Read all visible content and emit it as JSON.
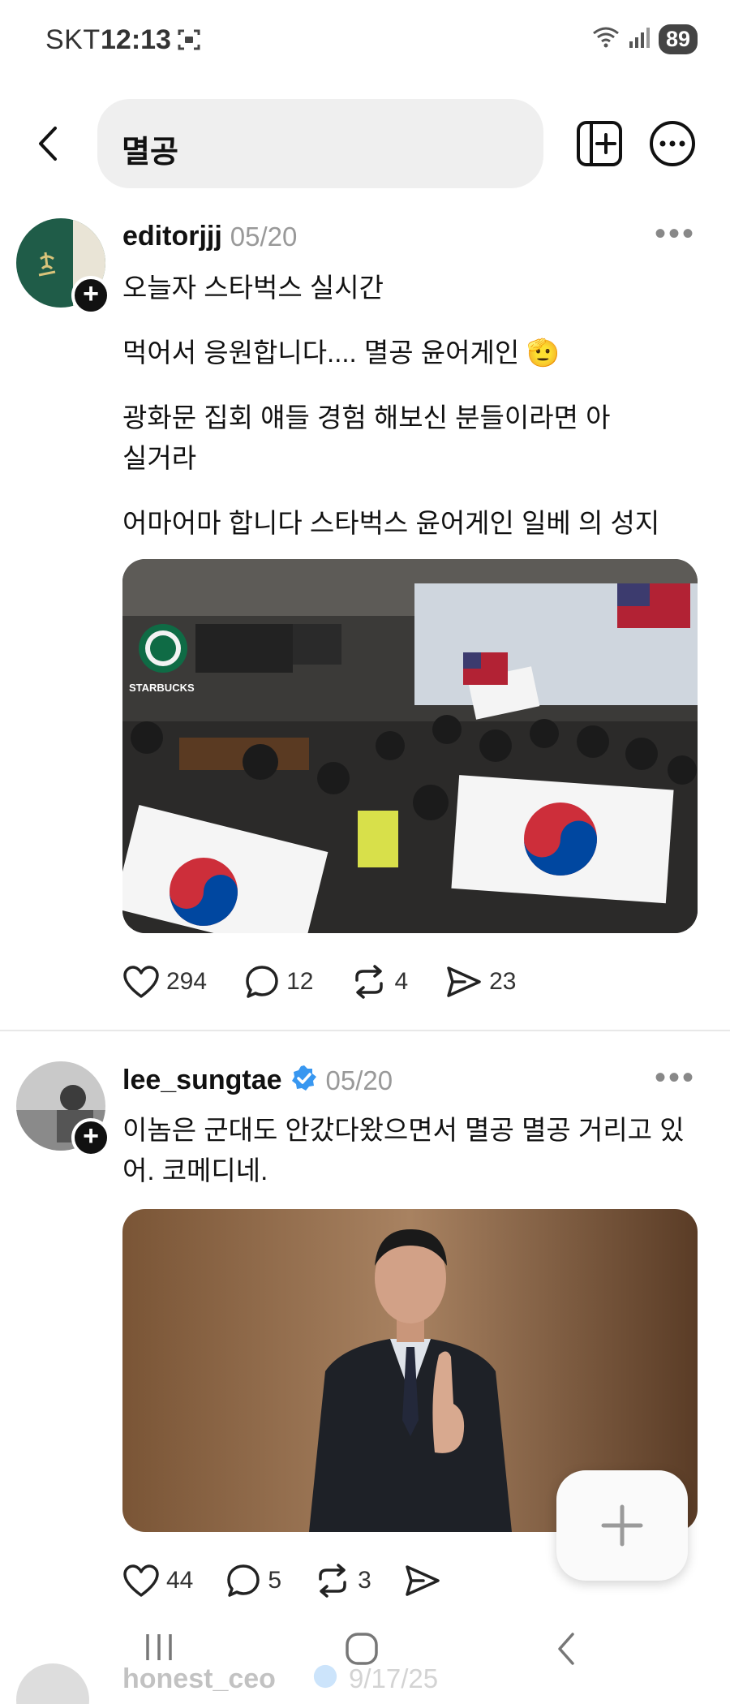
{
  "status_bar": {
    "carrier": "SKT",
    "time": "12:13",
    "battery": "89"
  },
  "header": {
    "search_text": "멸공"
  },
  "posts": [
    {
      "username": "editorjjj",
      "verified": false,
      "date": "05/20",
      "paragraphs": [
        "오늘자 스타벅스 실시간",
        "먹어서 응원합니다.... 멸공 윤어게인 🫡",
        "광화문 집회 얘들 경험 해보신 분들이라면 아실거라",
        "어마어마 합니다 스타벅스  윤어게인 일베 의 성지"
      ],
      "image_text": "STARBUCKS",
      "likes": "294",
      "comments": "12",
      "reposts": "4",
      "shares": "23"
    },
    {
      "username": "lee_sungtae",
      "verified": true,
      "date": "05/20",
      "paragraphs": [
        "이놈은 군대도 안갔다왔으면서 멸공 멸공 거리고 있어. 코메디네."
      ],
      "likes": "44",
      "comments": "5",
      "reposts": "3",
      "shares": ""
    }
  ],
  "next_post": {
    "username": "honest_ceo",
    "date": "9/17/25"
  },
  "colors": {
    "verified": "#3897f0",
    "muted": "#999999",
    "text": "#111111"
  }
}
